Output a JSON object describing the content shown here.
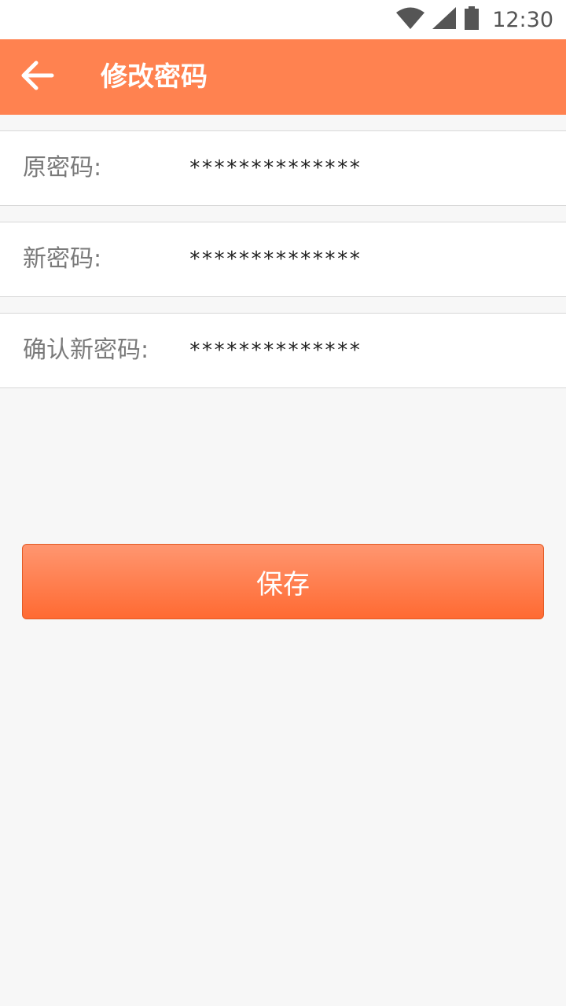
{
  "status_bar": {
    "time": "12:30",
    "icons": [
      "wifi-icon",
      "signal-icon",
      "battery-icon"
    ]
  },
  "app_bar": {
    "title": "修改密码",
    "back_icon": "arrow-left-icon",
    "color": "#ff8250"
  },
  "form": {
    "fields": [
      {
        "label": "原密码:",
        "value": "**************"
      },
      {
        "label": "新密码:",
        "value": "**************"
      },
      {
        "label": "确认新密码:",
        "value": "**************"
      }
    ]
  },
  "save_button": {
    "label": "保存",
    "color": "#ff6a32"
  }
}
